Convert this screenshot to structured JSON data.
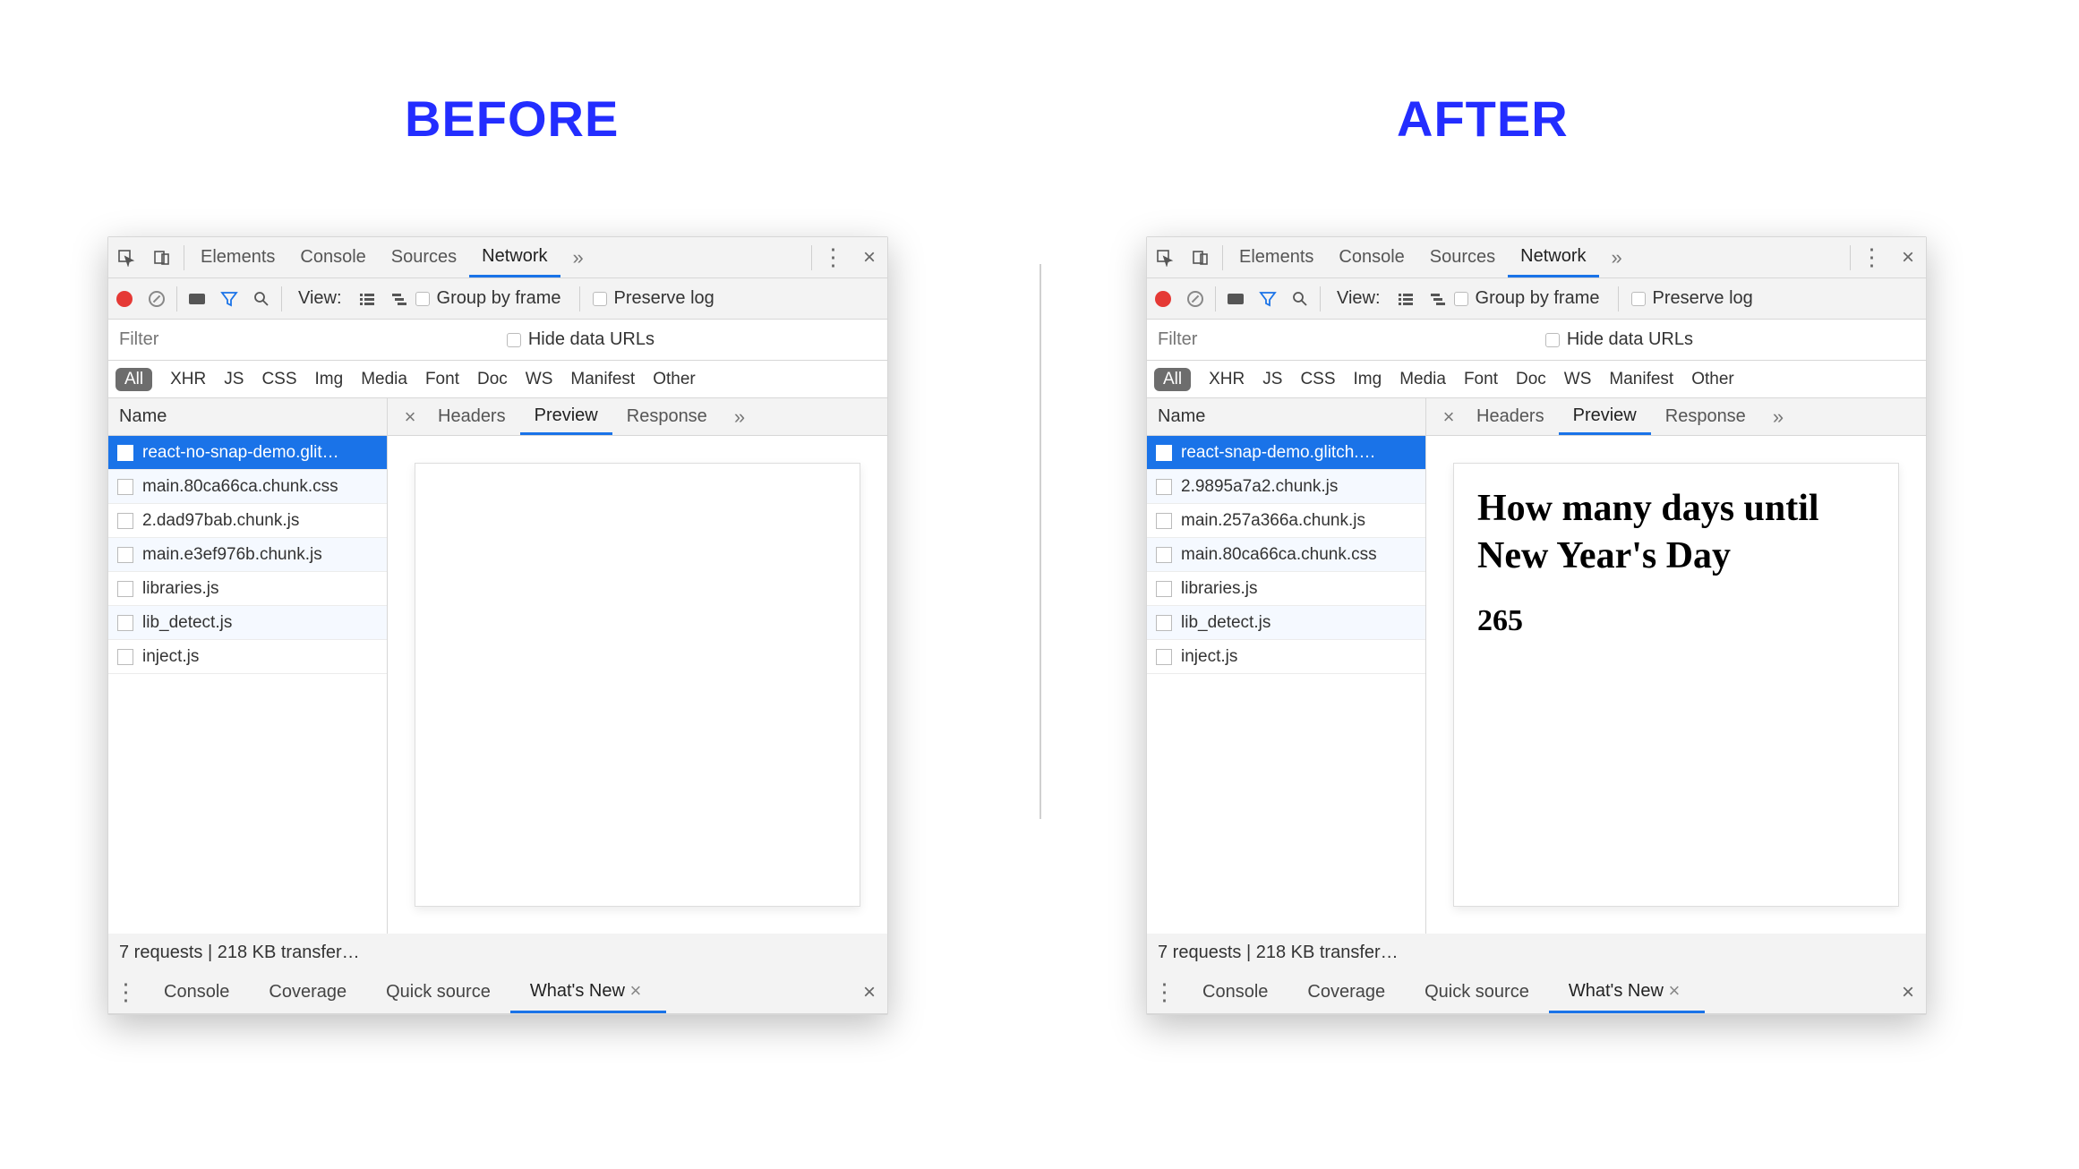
{
  "headings": {
    "before": "BEFORE",
    "after": "AFTER"
  },
  "tabs": {
    "elements": "Elements",
    "console": "Console",
    "sources": "Sources",
    "network": "Network"
  },
  "toolbar": {
    "view": "View:",
    "group_by_frame": "Group by frame",
    "preserve_log": "Preserve log",
    "hide_data_urls": "Hide data URLs"
  },
  "filter": {
    "placeholder": "Filter"
  },
  "types": {
    "all": "All",
    "xhr": "XHR",
    "js": "JS",
    "css": "CSS",
    "img": "Img",
    "media": "Media",
    "font": "Font",
    "doc": "Doc",
    "ws": "WS",
    "manifest": "Manifest",
    "other": "Other"
  },
  "columns": {
    "name": "Name"
  },
  "detail_tabs": {
    "headers": "Headers",
    "preview": "Preview",
    "response": "Response"
  },
  "status": "7 requests | 218 KB transfer…",
  "drawer": {
    "console": "Console",
    "coverage": "Coverage",
    "quick_source": "Quick source",
    "whats_new": "What's New"
  },
  "before": {
    "files": [
      "react-no-snap-demo.glit…",
      "main.80ca66ca.chunk.css",
      "2.dad97bab.chunk.js",
      "main.e3ef976b.chunk.js",
      "libraries.js",
      "lib_detect.js",
      "inject.js"
    ],
    "preview": {
      "title": "",
      "count": ""
    }
  },
  "after": {
    "files": [
      "react-snap-demo.glitch.…",
      "2.9895a7a2.chunk.js",
      "main.257a366a.chunk.js",
      "main.80ca66ca.chunk.css",
      "libraries.js",
      "lib_detect.js",
      "inject.js"
    ],
    "preview": {
      "title": "How many days until New Year's Day",
      "count": "265"
    }
  }
}
